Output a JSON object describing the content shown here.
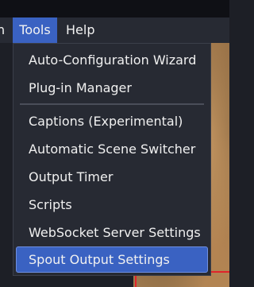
{
  "menubar": {
    "partial_label": "n",
    "tools_label": "Tools",
    "help_label": "Help"
  },
  "tools_menu": {
    "items": [
      {
        "label": "Auto-Configuration Wizard"
      },
      {
        "label": "Plug-in Manager"
      },
      {
        "label": "Captions (Experimental)"
      },
      {
        "label": "Automatic Scene Switcher"
      },
      {
        "label": "Output Timer"
      },
      {
        "label": "Scripts"
      },
      {
        "label": "WebSocket Server Settings"
      },
      {
        "label": "Spout Output Settings",
        "selected": true
      }
    ]
  },
  "colors": {
    "accent": "#3a62c2",
    "menu_background": "#272a33",
    "text": "#f0f0f0",
    "preview_border": "#e0242b"
  }
}
